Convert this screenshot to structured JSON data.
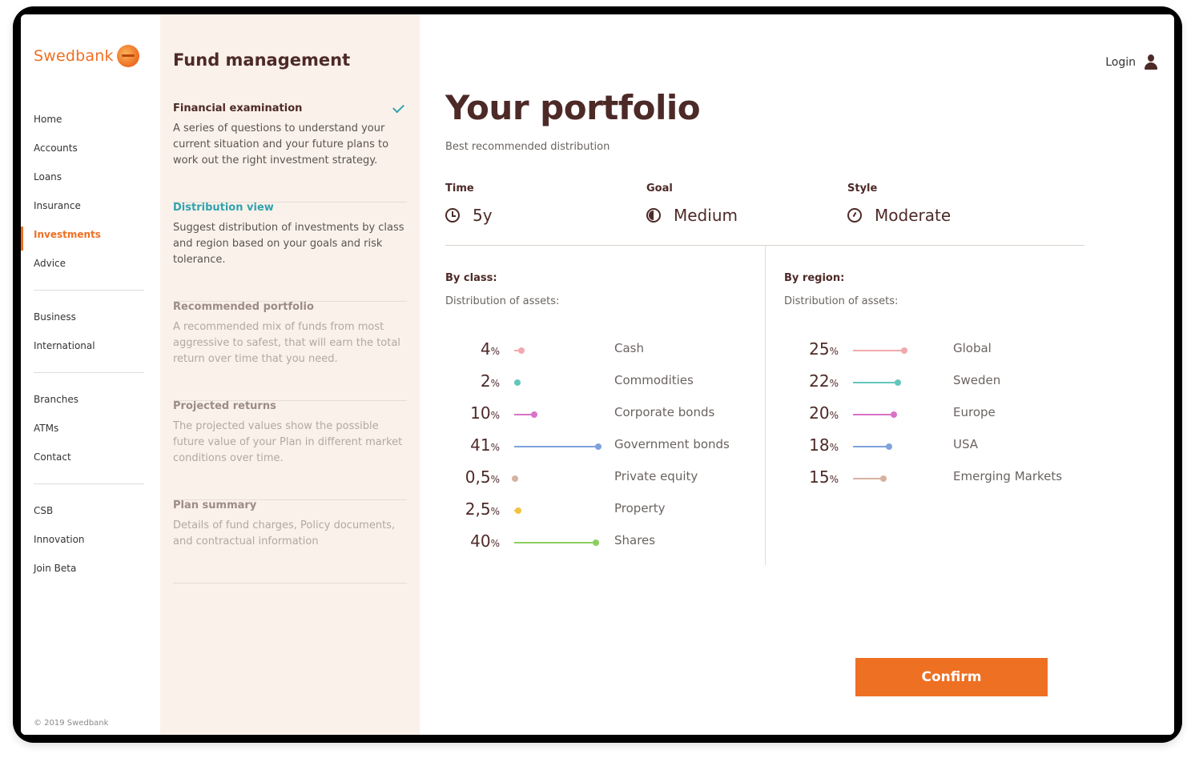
{
  "brand": {
    "name": "Swedbank",
    "copyright": "© 2019 Swedbank"
  },
  "nav": {
    "groups": [
      [
        {
          "label": "Home"
        },
        {
          "label": "Accounts"
        },
        {
          "label": "Loans"
        },
        {
          "label": "Insurance"
        },
        {
          "label": "Investments",
          "active": true
        },
        {
          "label": "Advice"
        }
      ],
      [
        {
          "label": "Business"
        },
        {
          "label": "International"
        }
      ],
      [
        {
          "label": "Branches"
        },
        {
          "label": "ATMs"
        },
        {
          "label": "Contact"
        }
      ],
      [
        {
          "label": "CSB"
        },
        {
          "label": "Innovation"
        },
        {
          "label": "Join Beta"
        }
      ]
    ]
  },
  "steps": {
    "title": "Fund management",
    "items": [
      {
        "title": "Financial examination",
        "desc": "A series of questions to understand your current situation and your future plans to work out the right investment strategy.",
        "state": "done"
      },
      {
        "title": "Distribution view",
        "desc": "Suggest distribution of investments by class and region based on your goals and risk tolerance.",
        "state": "current"
      },
      {
        "title": "Recommended portfolio",
        "desc": "A recommended mix of funds from most aggressive to safest, that will earn the total return over time that you need.",
        "state": "pending"
      },
      {
        "title": "Projected returns",
        "desc": "The projected values show the possible future value of your Plan in different market conditions over time.",
        "state": "pending"
      },
      {
        "title": "Plan summary",
        "desc": "Details of fund charges, Policy documents, and contractual information",
        "state": "pending"
      }
    ]
  },
  "header": {
    "login_label": "Login"
  },
  "portfolio": {
    "title": "Your portfolio",
    "subtitle": "Best recommended distribution",
    "facts": {
      "time": {
        "label": "Time",
        "value": "5y",
        "icon": "clock-icon"
      },
      "goal": {
        "label": "Goal",
        "value": "Medium",
        "icon": "goal-icon"
      },
      "style": {
        "label": "Style",
        "value": "Moderate",
        "icon": "gauge-icon"
      }
    },
    "by_class": {
      "title": "By class:",
      "subtitle": "Distribution of assets:",
      "items": [
        {
          "value": "4",
          "label": "Cash",
          "color": "#f2a9ad",
          "fraction": 0.04
        },
        {
          "value": "2",
          "label": "Commodities",
          "color": "#63c7bb",
          "fraction": 0.02
        },
        {
          "value": "10",
          "label": "Corporate bonds",
          "color": "#d873c7",
          "fraction": 0.1
        },
        {
          "value": "41",
          "label": "Government bonds",
          "color": "#7fa2dd",
          "fraction": 0.41
        },
        {
          "value": "0,5",
          "label": "Private equity",
          "color": "#d7b2a0",
          "fraction": 0.005
        },
        {
          "value": "2,5",
          "label": "Property",
          "color": "#efc442",
          "fraction": 0.025
        },
        {
          "value": "40",
          "label": "Shares",
          "color": "#8bcf5f",
          "fraction": 0.4
        }
      ]
    },
    "by_region": {
      "title": "By region:",
      "subtitle": "Distribution of assets:",
      "items": [
        {
          "value": "25",
          "label": "Global",
          "color": "#f2a9ad",
          "fraction": 0.25
        },
        {
          "value": "22",
          "label": "Sweden",
          "color": "#63c7bb",
          "fraction": 0.22
        },
        {
          "value": "20",
          "label": "Europe",
          "color": "#d873c7",
          "fraction": 0.2
        },
        {
          "value": "18",
          "label": "USA",
          "color": "#7fa2dd",
          "fraction": 0.18
        },
        {
          "value": "15",
          "label": "Emerging Markets",
          "color": "#d7b2a0",
          "fraction": 0.15
        }
      ]
    },
    "percent_sign": "%",
    "confirm_label": "Confirm"
  },
  "colors": {
    "accent": "#ee7023",
    "heading": "#4d2a27",
    "teal": "#31a3ae",
    "panel": "#faf1ea"
  }
}
